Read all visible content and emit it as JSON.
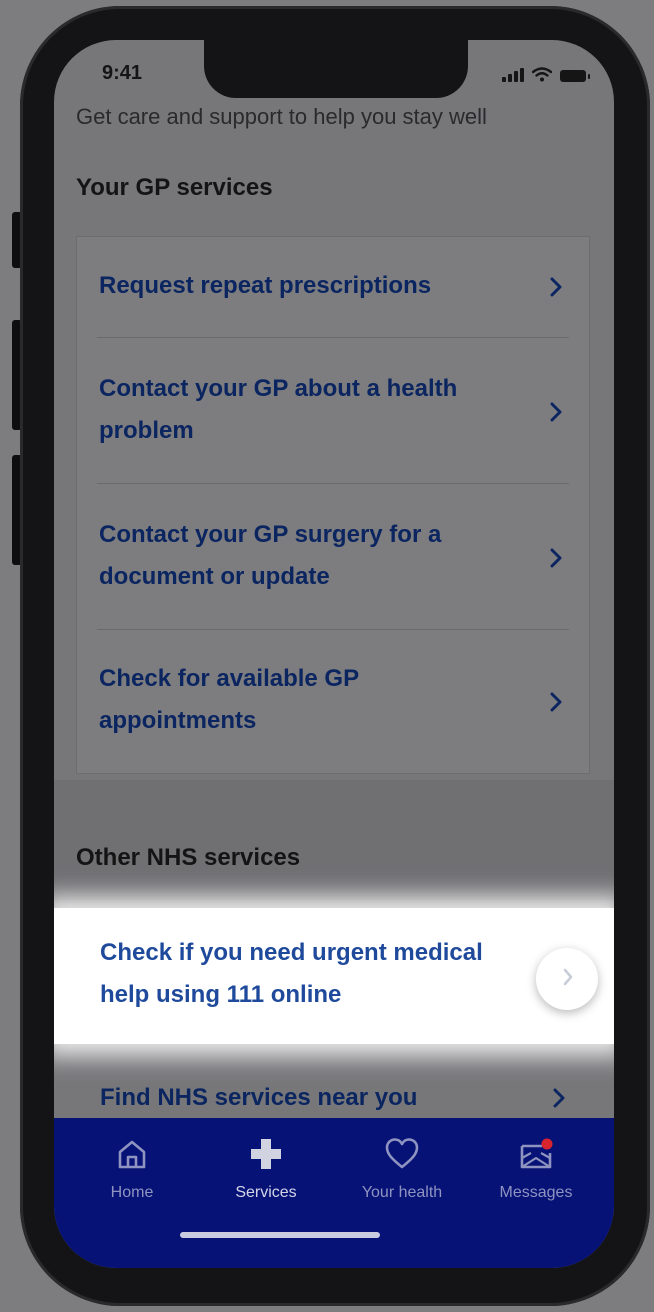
{
  "status_bar": {
    "time": "9:41"
  },
  "page": {
    "subtitle": "Get care and support to help you stay well"
  },
  "gp_section": {
    "heading": "Your GP services",
    "items": [
      {
        "label": "Request repeat prescriptions"
      },
      {
        "label": "Contact your GP about a health problem"
      },
      {
        "label": "Contact your GP surgery for a document or update"
      },
      {
        "label": "Check for available GP appointments"
      }
    ]
  },
  "other_section": {
    "heading": "Other NHS services",
    "items": [
      {
        "label": "Check if you need urgent medical help using 111 online"
      },
      {
        "label": "Find NHS services near you"
      }
    ]
  },
  "tab_bar": {
    "active": "Services",
    "tabs": [
      {
        "label": "Home",
        "icon": "home-icon"
      },
      {
        "label": "Services",
        "icon": "plus-icon"
      },
      {
        "label": "Your health",
        "icon": "heart-icon"
      },
      {
        "label": "Messages",
        "icon": "envelope-icon"
      }
    ]
  },
  "colors": {
    "nhs_blue": "#061276",
    "link_blue": "#0b2560",
    "notification_dot": "#d8242c",
    "overlay_grey": "#77777a"
  }
}
